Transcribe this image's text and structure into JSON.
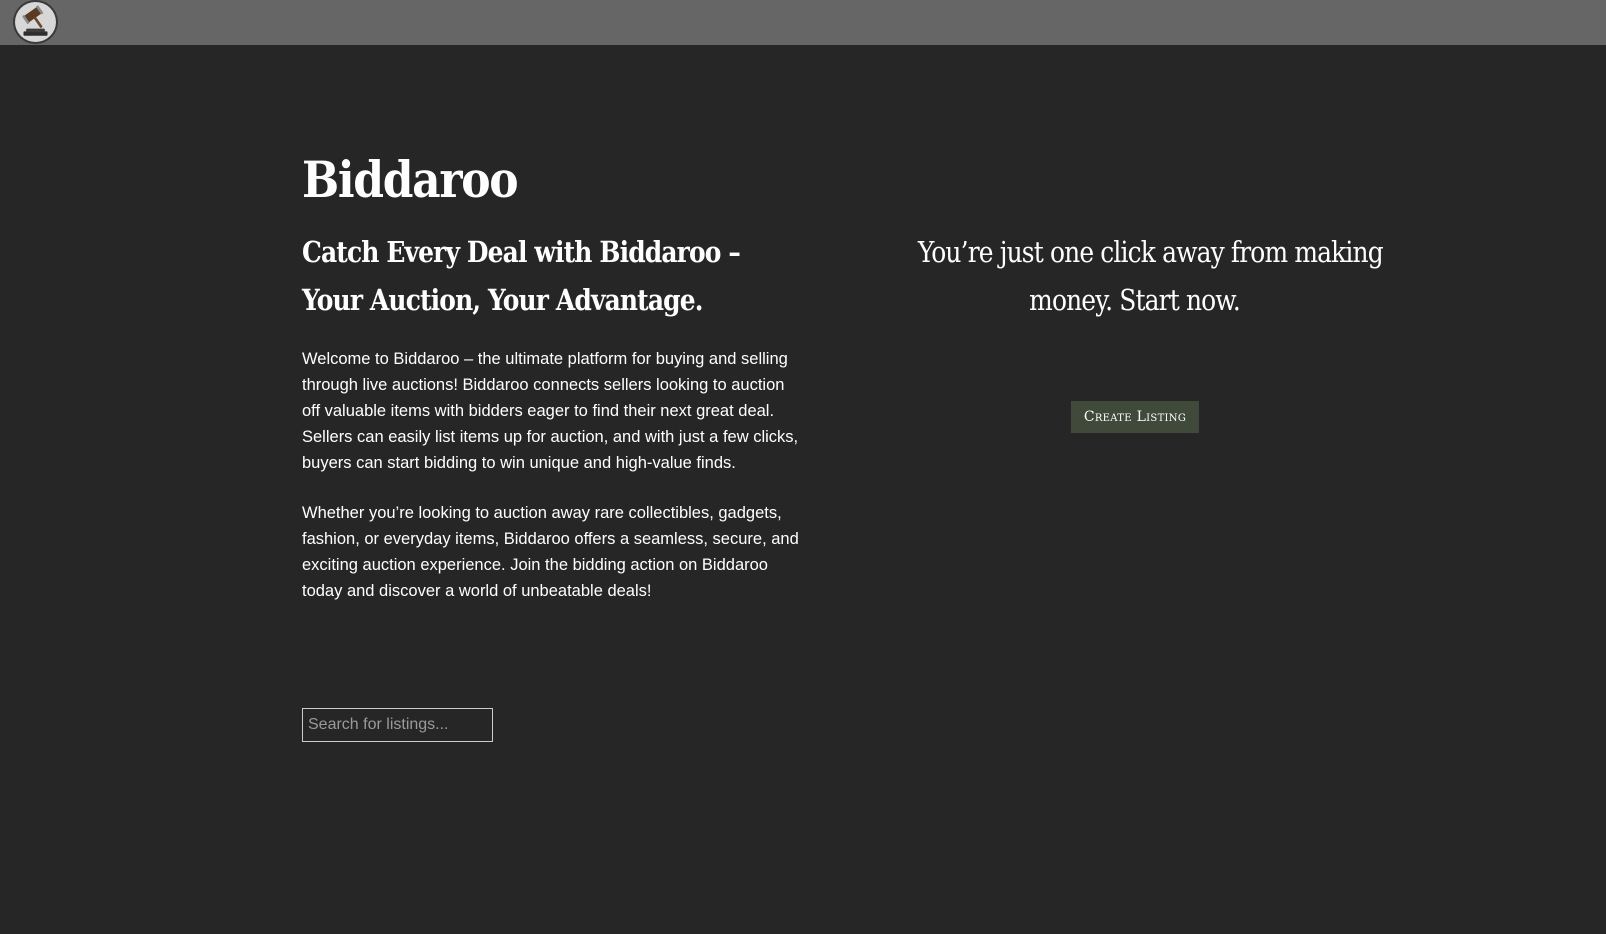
{
  "header": {
    "logo_icon": "gavel-icon"
  },
  "hero": {
    "brand": "Biddaroo",
    "tagline": "Catch Every Deal with Biddaroo – Your Auction, Your Advantage.",
    "paragraphs": [
      "Welcome to Biddaroo – the ultimate platform for buying and selling through live auctions! Biddaroo connects sellers looking to auction off valuable items with bidders eager to find their next great deal. Sellers can easily list items up for auction, and with just a few clicks, buyers can start bidding to win unique and high-value finds.",
      "Whether you’re looking to auction away rare collectibles, gadgets, fashion, or everyday items, Biddaroo offers a seamless, secure, and exciting auction experience. Join the bidding action on Biddaroo today and discover a world of unbeatable deals!"
    ]
  },
  "search": {
    "placeholder": "Search for listings...",
    "value": ""
  },
  "cta": {
    "line1": "You’re just one click away from making",
    "line2": "money. Start now.",
    "button_label": "Create Listing"
  },
  "colors": {
    "background": "#262626",
    "topbar": "#666666",
    "button": "#3f4a3a"
  }
}
